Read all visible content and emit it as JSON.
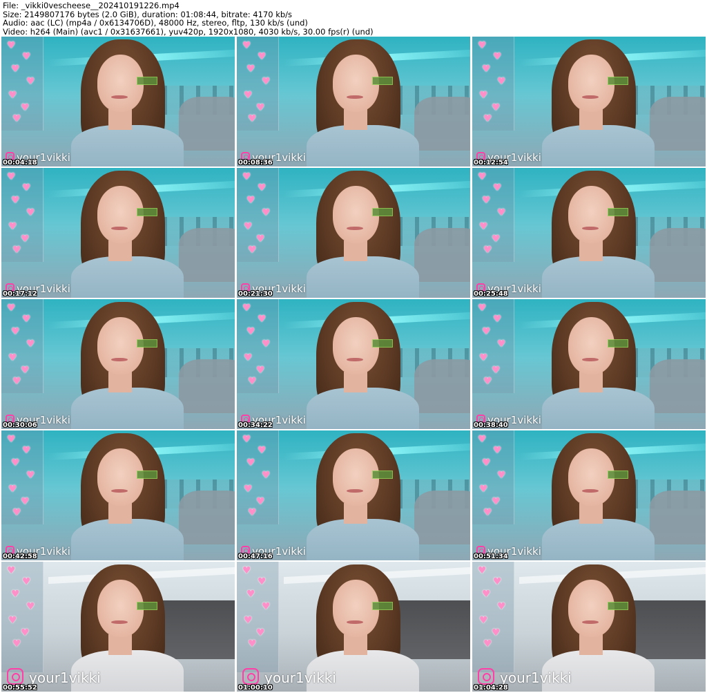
{
  "info": {
    "line1": "File: _vikki0vescheese__202410191226.mp4",
    "line2": "Size: 2149807176 bytes (2.0 GiB), duration: 01:08:44, bitrate: 4170 kb/s",
    "line3": "Audio: aac (LC) (mp4a / 0x6134706D), 48000 Hz, stereo, fltp, 130 kb/s (und)",
    "line4": "Video: h264 (Main) (avc1 / 0x31637661), yuv420p, 1920x1080, 4030 kb/s, 30.00 fps(r) (und)"
  },
  "watermark": "your1vikki",
  "icons": {
    "watermark_icon": "instagram-icon",
    "overlay_icon": "heart-icon"
  },
  "colors": {
    "heart": "#ff8fc8",
    "instagram": "#ff3fa8",
    "teal_room": "#2fb3c2"
  },
  "thumbnails": [
    {
      "timestamp": "00:04:18",
      "scene": "teal"
    },
    {
      "timestamp": "00:08:36",
      "scene": "teal"
    },
    {
      "timestamp": "00:12:54",
      "scene": "teal"
    },
    {
      "timestamp": "00:17:12",
      "scene": "teal"
    },
    {
      "timestamp": "00:21:30",
      "scene": "teal"
    },
    {
      "timestamp": "00:25:48",
      "scene": "teal"
    },
    {
      "timestamp": "00:30:06",
      "scene": "teal"
    },
    {
      "timestamp": "00:34:22",
      "scene": "teal"
    },
    {
      "timestamp": "00:38:40",
      "scene": "teal"
    },
    {
      "timestamp": "00:42:58",
      "scene": "teal"
    },
    {
      "timestamp": "00:47:16",
      "scene": "teal"
    },
    {
      "timestamp": "00:51:34",
      "scene": "teal"
    },
    {
      "timestamp": "00:55:52",
      "scene": "bedroom"
    },
    {
      "timestamp": "01:00:10",
      "scene": "bedroom"
    },
    {
      "timestamp": "01:04:28",
      "scene": "bedroom"
    }
  ]
}
